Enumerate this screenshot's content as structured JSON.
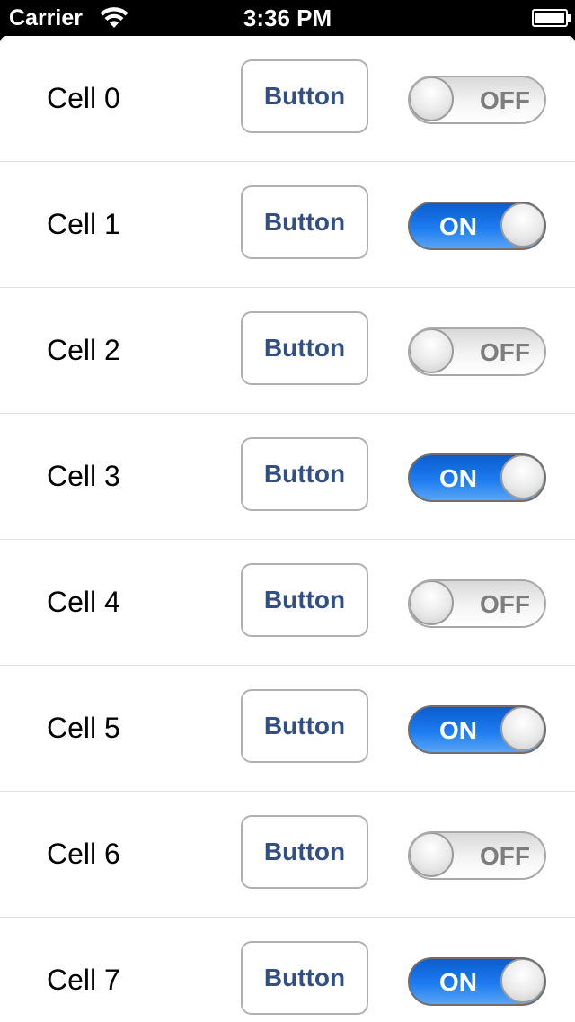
{
  "status_bar": {
    "carrier": "Carrier",
    "time": "3:36 PM",
    "icons": [
      "wifi-icon",
      "battery-icon"
    ]
  },
  "cells": [
    {
      "label": "Cell 0",
      "button": "Button",
      "switch": "OFF"
    },
    {
      "label": "Cell 1",
      "button": "Button",
      "switch": "ON"
    },
    {
      "label": "Cell 2",
      "button": "Button",
      "switch": "OFF"
    },
    {
      "label": "Cell 3",
      "button": "Button",
      "switch": "ON"
    },
    {
      "label": "Cell 4",
      "button": "Button",
      "switch": "OFF"
    },
    {
      "label": "Cell 5",
      "button": "Button",
      "switch": "ON"
    },
    {
      "label": "Cell 6",
      "button": "Button",
      "switch": "OFF"
    },
    {
      "label": "Cell 7",
      "button": "Button",
      "switch": "ON"
    }
  ],
  "colors": {
    "button_text": "#324f85",
    "switch_on": "#1d7cf0",
    "switch_off_text": "#7d7d7d"
  }
}
